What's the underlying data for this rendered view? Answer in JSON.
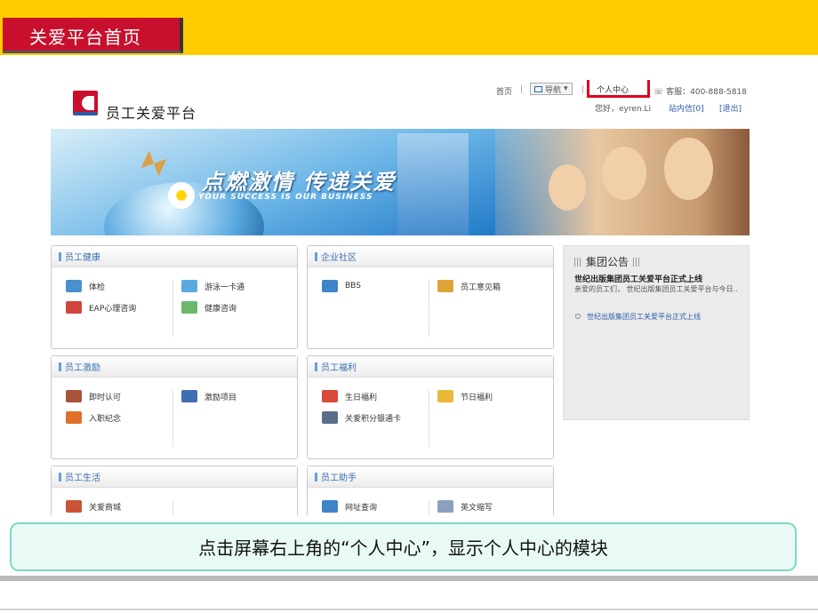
{
  "slide": {
    "title": "关爱平台首页"
  },
  "site": {
    "logo_text": "员工关爱平台",
    "nav": {
      "home": "首页",
      "sep": "|",
      "guide": "导航",
      "personal_center": "个人中心",
      "phone": "客服：400-888-5818"
    },
    "user": {
      "greeting": "您好，eyren.Li",
      "messages": "站内信[0]",
      "logout": "[退出]"
    },
    "banner": {
      "slogan": "点燃激情 传递关爱",
      "slogan_en": "YOUR SUCCESS IS OUR BUSINESS"
    }
  },
  "modules": [
    {
      "title": "员工健康",
      "items": [
        "体检",
        "游泳一卡通",
        "EAP心理咨询",
        "健康咨询"
      ]
    },
    {
      "title": "企业社区",
      "items": [
        "BBS",
        "员工意见箱"
      ]
    },
    {
      "title": "员工激励",
      "items": [
        "即时认可",
        "激励项目",
        "入职纪念"
      ]
    },
    {
      "title": "员工福利",
      "items": [
        "生日福利",
        "节日福利",
        "关爱积分银通卡"
      ]
    },
    {
      "title": "员工生活",
      "items": [
        "关爱商城"
      ]
    },
    {
      "title": "员工助手",
      "items": [
        "网址查询",
        "英文缩写"
      ]
    }
  ],
  "notice": {
    "heading": "集团公告",
    "title": "世纪出版集团员工关爱平台正式上线",
    "body": "亲爱的员工们， 世纪出版集团员工关爱平台与今日..",
    "link": "世纪出版集团员工关爱平台正式上线"
  },
  "caption": "点击屏幕右上角的“个人中心”，显示个人中心的模块",
  "colors": {
    "header": "#ffcc00",
    "title_box": "#c8102e",
    "highlight": "#e0001b",
    "caption_border": "#7ed8c4"
  }
}
